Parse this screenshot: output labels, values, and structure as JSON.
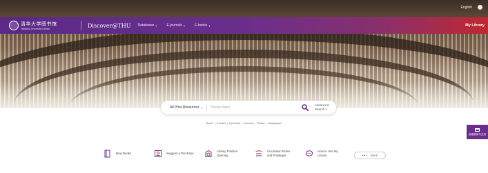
{
  "topbar": {
    "lang": "English"
  },
  "nav": {
    "logo_cn": "清华大学图书馆",
    "logo_en": "Tsinghua University Library",
    "brand": "Discover@THU",
    "items": [
      {
        "label": "Databases"
      },
      {
        "label": "E-journals"
      },
      {
        "label": "E-books"
      }
    ],
    "my_library": "My Library"
  },
  "search": {
    "scope": "All Print Resources",
    "placeholder": "Please Input",
    "advanced_line1": "Advanced",
    "advanced_line2": "Search >"
  },
  "quicklinks": [
    "Books",
    "E-books",
    "E-journals",
    "Journals",
    "Theses",
    "Newspapers"
  ],
  "float_tab": {
    "label": "读者服务与交流"
  },
  "services": [
    {
      "icon": "book-icon",
      "line1": "New Books",
      "line2": ""
    },
    {
      "icon": "suggest-icon",
      "line1": "Suggest a Purchase",
      "line2": ""
    },
    {
      "icon": "clock-icon",
      "line1": "Library Position",
      "line2": "Opening"
    },
    {
      "icon": "rules-icon",
      "line1": "Circulation Rules",
      "line2": "and Privileges"
    },
    {
      "icon": "chat-icon",
      "line1": "How to Use My",
      "line2": "Library"
    }
  ],
  "more": {
    "label": "More"
  },
  "colors": {
    "primary": "#6a2f8c",
    "accent_red": "#c0282f"
  }
}
